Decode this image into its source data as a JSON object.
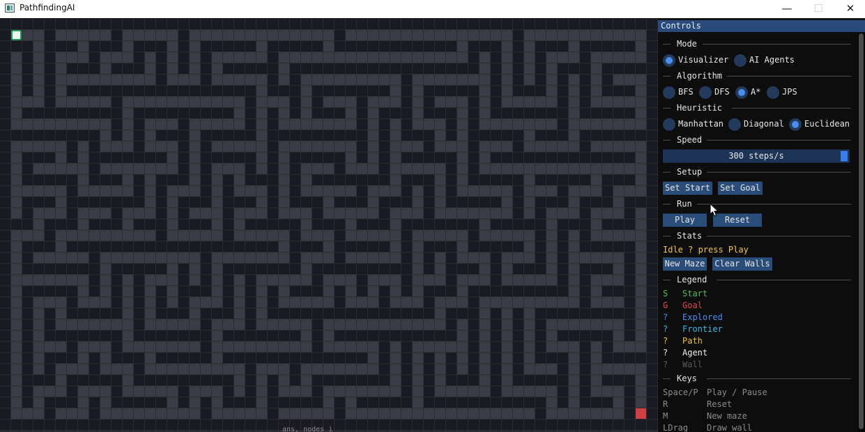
{
  "window": {
    "title": "PathfindingAI",
    "minimize_glyph": "—",
    "maximize_glyph": "☐",
    "close_glyph": "✕"
  },
  "grid": {
    "cols": 59,
    "rows": 37,
    "start_cell": [
      1,
      1
    ],
    "goal_cell": [
      57,
      35
    ],
    "caption_partial": "ans, nodes i"
  },
  "colors": {
    "wall": "#1a1b22",
    "floor": "#3a3b44",
    "start": "#22a05a",
    "goal": "#d04040",
    "panel_header": "#294a7a",
    "button": "#2a4c79",
    "radio_on": "#4a8ef0"
  },
  "controls": {
    "title": "Controls",
    "mode": {
      "label": "Mode",
      "options": [
        {
          "label": "Visualizer",
          "selected": true
        },
        {
          "label": "AI Agents",
          "selected": false
        }
      ]
    },
    "algorithm": {
      "label": "Algorithm",
      "options": [
        {
          "label": "BFS",
          "selected": false
        },
        {
          "label": "DFS",
          "selected": false
        },
        {
          "label": "A*",
          "selected": true
        },
        {
          "label": "JPS",
          "selected": false
        }
      ]
    },
    "heuristic": {
      "label": "Heuristic",
      "options": [
        {
          "label": "Manhattan",
          "selected": false
        },
        {
          "label": "Diagonal",
          "selected": false
        },
        {
          "label": "Euclidean",
          "selected": true
        }
      ]
    },
    "speed": {
      "label": "Speed",
      "value_text": "300 steps/s",
      "fraction": 1.0
    },
    "setup": {
      "label": "Setup",
      "set_start": "Set Start",
      "set_goal": "Set Goal"
    },
    "run": {
      "label": "Run",
      "play": "Play",
      "reset": "Reset"
    },
    "stats": {
      "label": "Stats",
      "status": "Idle ? press Play",
      "new_maze": "New Maze",
      "clear_walls": "Clear Walls"
    },
    "legend": {
      "label": "Legend",
      "items": [
        {
          "symbol": "S",
          "name": "Start",
          "color": "#4cc05a"
        },
        {
          "symbol": "G",
          "name": "Goal",
          "color": "#e04848"
        },
        {
          "symbol": "?",
          "name": "Explored",
          "color": "#4a8ef0"
        },
        {
          "symbol": "?",
          "name": "Frontier",
          "color": "#38b8e8"
        },
        {
          "symbol": "?",
          "name": "Path",
          "color": "#f0c030"
        },
        {
          "symbol": "?",
          "name": "Agent",
          "color": "#f0f0f0"
        },
        {
          "symbol": "?",
          "name": "Wall",
          "color": "#5a5a5a"
        }
      ]
    },
    "keys": {
      "label": "Keys",
      "items": [
        {
          "key": "Space/P",
          "action": "Play / Pause"
        },
        {
          "key": "R",
          "action": "Reset"
        },
        {
          "key": "M",
          "action": "New maze"
        },
        {
          "key": "LDrag",
          "action": "Draw wall"
        }
      ]
    }
  }
}
